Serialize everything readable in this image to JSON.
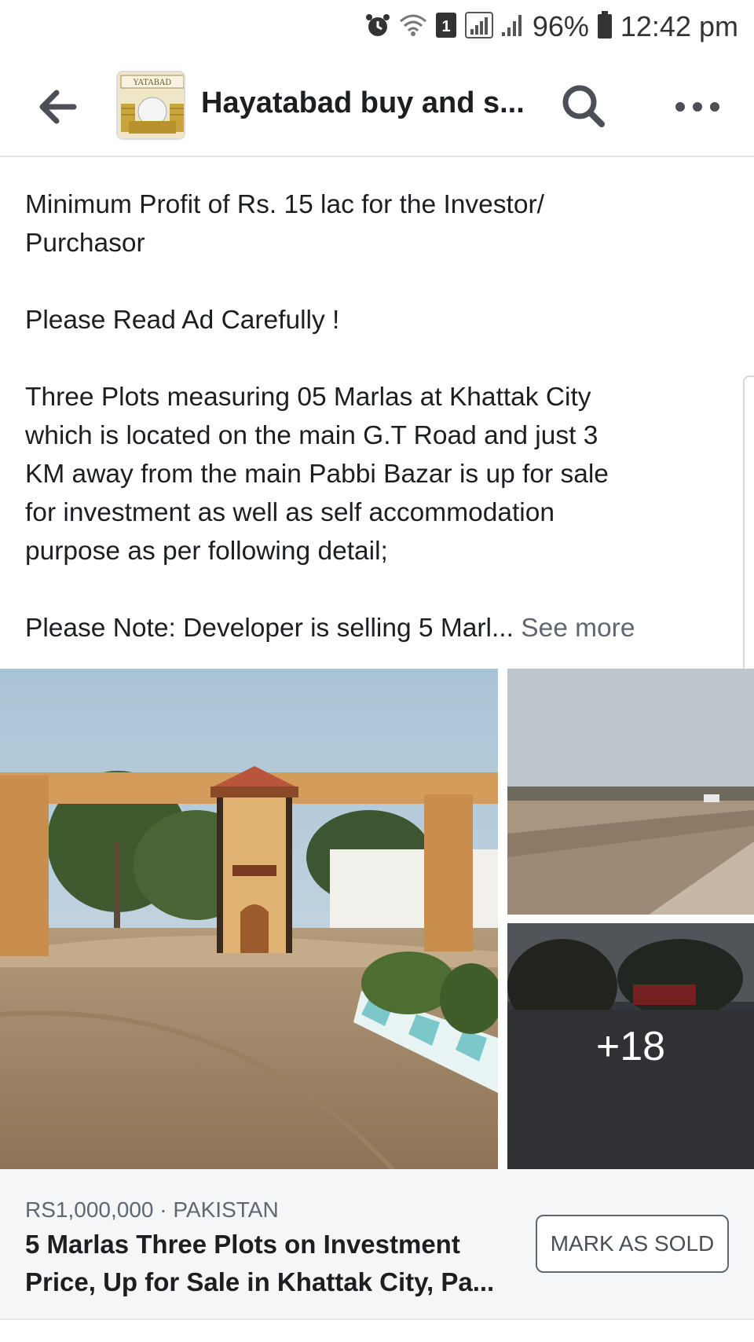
{
  "status_bar": {
    "icons": [
      "alarm-icon",
      "wifi-icon",
      "sim-icon",
      "signal-icon",
      "signal-icon",
      "battery-icon"
    ],
    "sim_number": "1",
    "battery": "96%",
    "time": "12:42 pm"
  },
  "header": {
    "title": "Hayatabad buy and s...",
    "back_icon": "back-arrow-icon",
    "search_icon": "search-icon",
    "more_icon": "more-icon",
    "avatar_text": "YATABAD"
  },
  "post": {
    "line1": "Minimum Profit of Rs. 15 lac for the Investor/",
    "line2": "Purchasor",
    "line3": "Please Read Ad Carefully !",
    "line4": "Three Plots measuring 05 Marlas at Khattak City",
    "line5": "which is located on the main G.T Road and just 3",
    "line6": "KM away from the main Pabbi Bazar is up for sale",
    "line7": "for investment as well as self accommodation",
    "line8": "purpose as per following detail;",
    "line9": "Please Note: Developer is selling 5 Marl...",
    "see_more": "See more"
  },
  "photos": {
    "more_count": "+18"
  },
  "listing": {
    "meta": "RS1,000,000 · PAKISTAN",
    "title_line1": "5 Marlas Three Plots on Investment",
    "title_line2": "Price, Up for Sale in Khattak City, Pa...",
    "mark_sold_label": "MARK AS SOLD"
  },
  "colors": {
    "text_primary": "#1c1e21",
    "text_secondary": "#606770",
    "background": "#ffffff",
    "listing_bg": "#f5f6f7"
  }
}
